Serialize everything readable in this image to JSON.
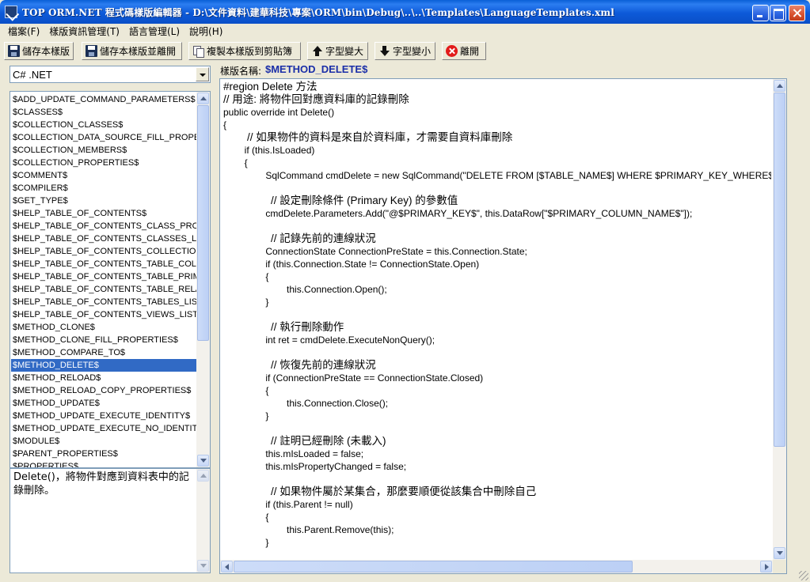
{
  "window": {
    "title": "TOP ORM.NET 程式碼樣版編輯器 - D:\\文件資料\\建華科技\\專案\\ORM\\bin\\Debug\\..\\..\\Templates\\LanguageTemplates.xml"
  },
  "menu": [
    {
      "label": "檔案(F)"
    },
    {
      "label": "樣版資訊管理(T)"
    },
    {
      "label": "語言管理(L)"
    },
    {
      "label": "說明(H)"
    }
  ],
  "toolbar": {
    "save": "儲存本樣版",
    "save_exit": "儲存本樣版並離開",
    "copy": "複製本樣版到剪貼簿",
    "font_bigger": "字型變大",
    "font_smaller": "字型變小",
    "exit": "離開"
  },
  "language_select": {
    "value": "C# .NET"
  },
  "template_list": {
    "selected": "$METHOD_DELETE$",
    "items": [
      "$ADD_UPDATE_COMMAND_PARAMETERS$",
      "$CLASSES$",
      "$COLLECTION_CLASSES$",
      "$COLLECTION_DATA_SOURCE_FILL_PROPERTIES$",
      "$COLLECTION_MEMBERS$",
      "$COLLECTION_PROPERTIES$",
      "$COMMENT$",
      "$COMPILER$",
      "$GET_TYPE$",
      "$HELP_TABLE_OF_CONTENTS$",
      "$HELP_TABLE_OF_CONTENTS_CLASS_PROPERTIES$",
      "$HELP_TABLE_OF_CONTENTS_CLASSES_LIST$",
      "$HELP_TABLE_OF_CONTENTS_COLLECTION",
      "$HELP_TABLE_OF_CONTENTS_TABLE_COLUMNS$",
      "$HELP_TABLE_OF_CONTENTS_TABLE_PRIMARY$",
      "$HELP_TABLE_OF_CONTENTS_TABLE_RELATIONS$",
      "$HELP_TABLE_OF_CONTENTS_TABLES_LIST$",
      "$HELP_TABLE_OF_CONTENTS_VIEWS_LIST$",
      "$METHOD_CLONE$",
      "$METHOD_CLONE_FILL_PROPERTIES$",
      "$METHOD_COMPARE_TO$",
      "$METHOD_DELETE$",
      "$METHOD_RELOAD$",
      "$METHOD_RELOAD_COPY_PROPERTIES$",
      "$METHOD_UPDATE$",
      "$METHOD_UPDATE_EXECUTE_IDENTITY$",
      "$METHOD_UPDATE_EXECUTE_NO_IDENTITY$",
      "$MODULE$",
      "$PARENT_PROPERTIES$",
      "$PROPERTIES$"
    ]
  },
  "description": "Delete()，將物件對應到資料表中的記錄刪除。",
  "template_name": {
    "label": "樣版名稱:",
    "value": "$METHOD_DELETE$"
  },
  "code_lines": [
    "#region Delete 方法",
    "// 用途: 將物件回對應資料庫的記錄刪除",
    "public override int Delete()",
    "{",
    "\t\t// 如果物件的資料是來自於資料庫，才需要自資料庫刪除",
    "\t\tif (this.IsLoaded)",
    "\t\t{",
    "\t\t\t\tSqlCommand cmdDelete = new SqlCommand(\"DELETE FROM [$TABLE_NAME$] WHERE $PRIMARY_KEY_WHERE$\", this.Connection);",
    "",
    "\t\t\t\t// 設定刪除條件 (Primary Key) 的參數值",
    "\t\t\t\tcmdDelete.Parameters.Add(\"@$PRIMARY_KEY$\", this.DataRow[\"$PRIMARY_COLUMN_NAME$\"]);",
    "",
    "\t\t\t\t// 記錄先前的連線狀況",
    "\t\t\t\tConnectionState ConnectionPreState = this.Connection.State;",
    "\t\t\t\tif (this.Connection.State != ConnectionState.Open)",
    "\t\t\t\t{",
    "\t\t\t\t\t\tthis.Connection.Open();",
    "\t\t\t\t}",
    "",
    "\t\t\t\t// 執行刪除動作",
    "\t\t\t\tint ret = cmdDelete.ExecuteNonQuery();",
    "",
    "\t\t\t\t// 恢復先前的連線狀況",
    "\t\t\t\tif (ConnectionPreState == ConnectionState.Closed)",
    "\t\t\t\t{",
    "\t\t\t\t\t\tthis.Connection.Close();",
    "\t\t\t\t}",
    "",
    "\t\t\t\t// 註明已經刪除 (未載入)",
    "\t\t\t\tthis.mIsLoaded = false;",
    "\t\t\t\tthis.mIsPropertyChanged = false;",
    "",
    "\t\t\t\t// 如果物件屬於某集合，那麼要順便從該集合中刪除自己",
    "\t\t\t\tif (this.Parent != null)",
    "\t\t\t\t{",
    "\t\t\t\t\t\tthis.Parent.Remove(this);",
    "\t\t\t\t}",
    ""
  ],
  "colors": {
    "selection": "#316ac5",
    "template_name": "#1a2ea8",
    "titlebar": "#0a5fd6"
  }
}
